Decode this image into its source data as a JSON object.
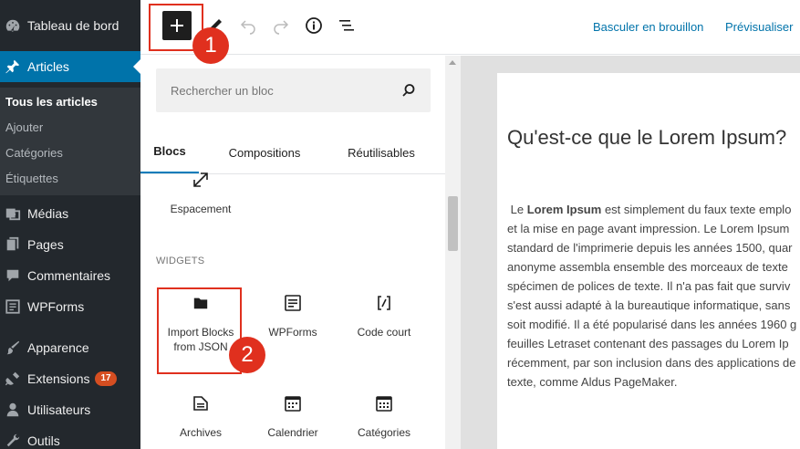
{
  "sidebar": {
    "items": [
      {
        "label": "Tableau de bord",
        "icon": "dashboard-icon"
      },
      {
        "label": "Articles",
        "icon": "pushpin-icon"
      },
      {
        "label": "Médias",
        "icon": "media-icon"
      },
      {
        "label": "Pages",
        "icon": "pages-icon"
      },
      {
        "label": "Commentaires",
        "icon": "comment-icon"
      },
      {
        "label": "WPForms",
        "icon": "wpforms-icon"
      },
      {
        "label": "Apparence",
        "icon": "brush-icon"
      },
      {
        "label": "Extensions",
        "icon": "plugin-icon",
        "badge": "17"
      },
      {
        "label": "Utilisateurs",
        "icon": "user-icon"
      },
      {
        "label": "Outils",
        "icon": "wrench-icon"
      }
    ],
    "submenu": [
      "Tous les articles",
      "Ajouter",
      "Catégories",
      "Étiquettes"
    ]
  },
  "toolbar": {
    "switch_to_draft": "Basculer en brouillon",
    "preview": "Prévisualiser"
  },
  "inserter": {
    "search_placeholder": "Rechercher un bloc",
    "tabs": [
      "Blocs",
      "Compositions",
      "Réutilisables"
    ],
    "widgets_heading": "WIDGETS",
    "blocks": {
      "spacer": "Espacement",
      "import_blocks": "Import Blocks from JSON",
      "wpforms": "WPForms",
      "shortcode": "Code court",
      "archives": "Archives",
      "calendar": "Calendrier",
      "categories": "Catégories"
    }
  },
  "markers": {
    "one": "1",
    "two": "2"
  },
  "post": {
    "title": "Qu'est-ce que le Lorem Ipsum?",
    "body_bold": "Lorem Ipsum",
    "body_lines": [
      "est simplement du faux texte emplo",
      "et la mise en page avant impression. Le Lorem Ipsum",
      "standard de l'imprimerie depuis les années 1500, quar",
      "anonyme assembla ensemble des morceaux de texte",
      "spécimen de polices de texte. Il n'a pas fait que surviv",
      "s'est aussi adapté à la bureautique informatique, sans",
      "soit modifié. Il a été popularisé dans les années 1960 g",
      "feuilles Letraset contenant des passages du Lorem Ip",
      "récemment, par son inclusion dans des applications de",
      "texte, comme Aldus PageMaker."
    ]
  },
  "colors": {
    "accent": "#0073aa",
    "annotation": "#e0301e",
    "sidebar": "#23282d"
  }
}
